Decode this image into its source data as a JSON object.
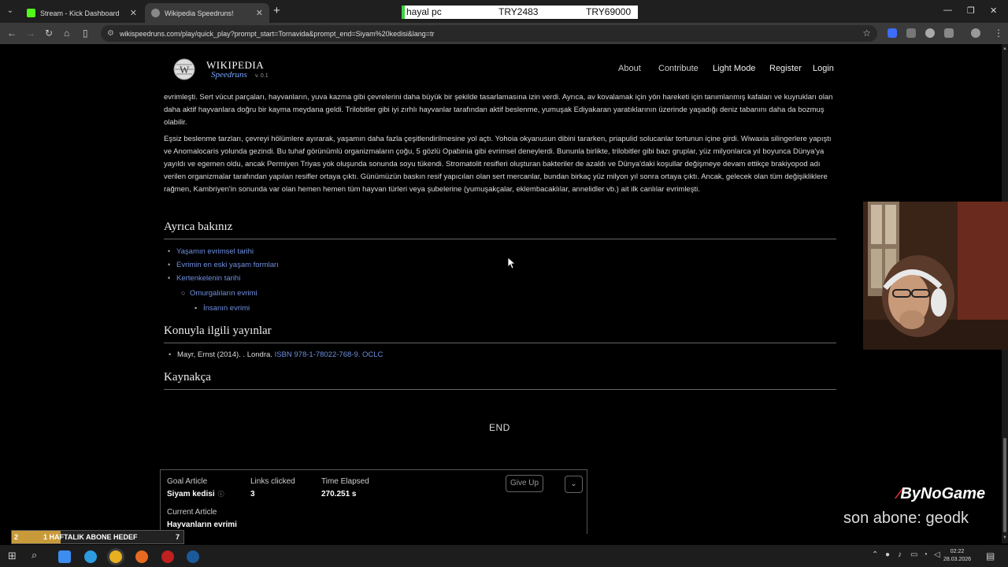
{
  "browser": {
    "tabs": [
      {
        "title": "Stream - Kick Dashboard",
        "active": false
      },
      {
        "title": "Wikipedia Speedruns!",
        "active": true
      }
    ],
    "url": "wikispeedruns.com/play/quick_play?prompt_start=Tornavida&prompt_end=Siyam%20kedisi&lang=tr"
  },
  "stream_overlay": {
    "top_label": "hayal pc",
    "top_value_1": "TRY2483",
    "top_value_2": "TRY69000",
    "brand": "ByNoGame",
    "last_sub": "son abone: geodk",
    "goal_label": "1 HAFTALIK ABONE HEDEF",
    "goal_current": "2",
    "goal_target": "7"
  },
  "site": {
    "logo_word1": "WIKIPEDIA",
    "logo_word2": "Speedruns",
    "version": "v. 0.1",
    "nav": {
      "about": "About",
      "contribute": "Contribute",
      "light_mode": "Light Mode",
      "register": "Register",
      "login": "Login"
    }
  },
  "article": {
    "para1": "evrimleşti. Sert vücut parçaları, hayvanların, yuva kazma gibi çevrelerini daha büyük bir şekilde tasarlamasına izin verdi. Ayrıca, av kovalamak için yön hareketi için tanımlanmış kafaları ve kuyrukları olan daha aktif hayvanlara doğru bir kayma meydana geldi. Trilobitler gibi iyi zırhlı hayvanlar tarafından aktif beslenme, yumuşak Ediyakaran yaratıklarının üzerinde yaşadığı deniz tabanını daha da bozmuş olabilir.",
    "para2": "Eşsiz beslenme tarzları, çevreyi hölümlere ayırarak, yaşamın daha fazla çeşitlendirilmesine yol açtı. Yohoia okyanusun dibini tararken, priapulid solucanlar tortunun içine girdi. Wiwaxia silingerlere yapıştı ve Anomalocaris yolunda gezindi. Bu tuhaf görünümlü organizmaların çoğu, 5 gözlü Opabinia gibi evrimsel deneylerdi. Bununla birlikte, trilobitler gibi bazı gruplar, yüz milyonlarca yıl boyunca Dünya'ya yayıldı ve egemen oldu, ancak Permiyen Triyas yok oluşunda sonunda soyu tükendi. Stromatolit resifleri oluşturan bakteriler de azaldı ve Dünya'daki koşullar değişmeye devam ettikçe brakiyopod adı verilen organizmalar tarafından yapılan resifler ortaya çıktı. Günümüzün baskın resif yapıcıları olan sert mercanlar, bundan birkaç yüz milyon yıl sonra ortaya çıktı. Ancak, gelecek olan tüm değişikliklere rağmen, Kambriyen'in sonunda var olan hemen hemen tüm hayvan türleri veya şubelerine (yumuşakçalar, eklembacaklılar, annelidler vb.) ait ilk canlılar evrimleşti.",
    "see_also_heading": "Ayrıca bakınız",
    "see_also": [
      "Yaşamın evrimsel tarihi",
      "Evrimin en eski yaşam formları",
      "Kertenkelenin tarihi",
      "Omurgalıların evrimi",
      "İnsanın evrimi"
    ],
    "publications_heading": "Konuyla ilgili yayınlar",
    "publication_text": "Mayr, Ernst (2014). . Londra.",
    "publication_isbn": "ISBN 978-1-78022-768-9. OCLC",
    "references_heading": "Kaynakça"
  },
  "end_label": "END",
  "game": {
    "goal_label": "Goal Article",
    "goal_value": "Siyam kedisi",
    "links_label": "Links clicked",
    "links_value": "3",
    "time_label": "Time Elapsed",
    "time_value": "270.251 s",
    "current_label": "Current Article",
    "current_value": "Hayvanların evrimi",
    "give_up": "Give Up"
  },
  "taskbar": {
    "time": "02:22",
    "date": "28.03.2026"
  }
}
